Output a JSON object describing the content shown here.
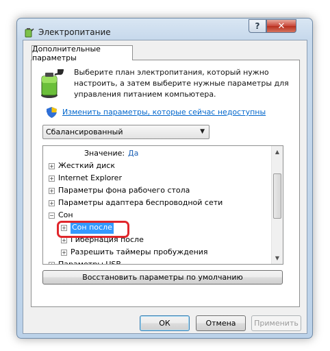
{
  "window": {
    "title": "Электропитание",
    "help_glyph": "?",
    "close_glyph": "✕"
  },
  "tab": {
    "label": "Дополнительные параметры"
  },
  "description": "Выберите план электропитания, который нужно настроить, а затем выберите нужные параметры для управления питанием компьютера.",
  "link": {
    "label": "Изменить параметры, которые сейчас недоступны"
  },
  "plan_select": {
    "value": "Сбалансированный",
    "arrow": "▼"
  },
  "tree": {
    "value_row": {
      "label": "Значение:",
      "value": "Да"
    },
    "items": [
      {
        "label": "Жесткий диск",
        "expander": "+"
      },
      {
        "label": "Internet Explorer",
        "expander": "+"
      },
      {
        "label": "Параметры фона рабочего стола",
        "expander": "+"
      },
      {
        "label": "Параметры адаптера беспроводной сети",
        "expander": "+"
      },
      {
        "label": "Сон",
        "expander": "−"
      },
      {
        "label": "Сон после",
        "expander": "+"
      },
      {
        "label": "Гибернация после",
        "expander": "+"
      },
      {
        "label": "Разрешить таймеры пробуждения",
        "expander": "+"
      },
      {
        "label": "Параметры USB",
        "expander": "+"
      }
    ],
    "scroll_up": "▲",
    "scroll_down": "▼"
  },
  "buttons": {
    "restore": "Восстановить параметры по умолчанию",
    "ok": "ОК",
    "cancel": "Отмена",
    "apply": "Применить"
  },
  "colors": {
    "link": "#0066cc",
    "selection": "#3399ff",
    "highlight_ring": "#e0262b",
    "value": "#1a5fb4"
  },
  "icons": {
    "app": "power-battery-icon",
    "plan": "battery-plug-icon",
    "shield": "uac-shield-icon"
  }
}
